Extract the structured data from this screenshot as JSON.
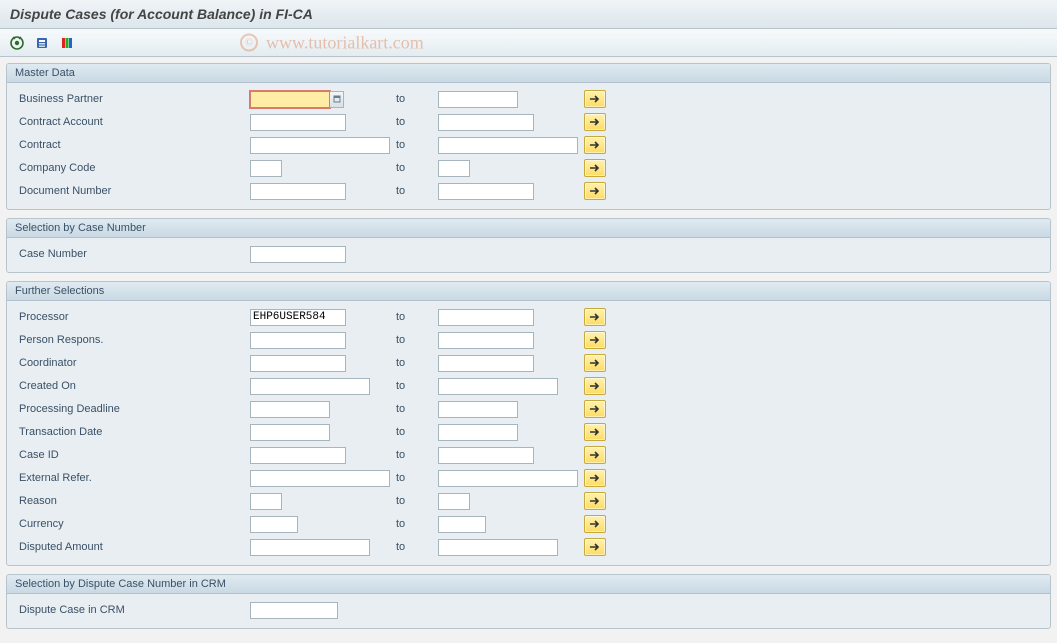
{
  "window_title": "Dispute Cases (for Account Balance) in FI-CA",
  "watermark": "www.tutorialkart.com",
  "toolbar": {
    "execute": "execute-icon",
    "variants": "variants-icon",
    "dynamic_selections": "dynamic-selections-icon"
  },
  "labels": {
    "to": "to"
  },
  "panels": {
    "master_data": {
      "title": "Master Data",
      "fields": {
        "business_partner": {
          "label": "Business Partner",
          "from": "",
          "to": ""
        },
        "contract_account": {
          "label": "Contract Account",
          "from": "",
          "to": ""
        },
        "contract": {
          "label": "Contract",
          "from": "",
          "to": ""
        },
        "company_code": {
          "label": "Company Code",
          "from": "",
          "to": ""
        },
        "document_number": {
          "label": "Document Number",
          "from": "",
          "to": ""
        }
      }
    },
    "case_number": {
      "title": "Selection by Case Number",
      "fields": {
        "case_number": {
          "label": "Case Number",
          "value": ""
        }
      }
    },
    "further": {
      "title": "Further Selections",
      "fields": {
        "processor": {
          "label": "Processor",
          "from": "EHP6USER584",
          "to": ""
        },
        "person_respons": {
          "label": "Person Respons.",
          "from": "",
          "to": ""
        },
        "coordinator": {
          "label": "Coordinator",
          "from": "",
          "to": ""
        },
        "created_on": {
          "label": "Created On",
          "from": "",
          "to": ""
        },
        "processing_deadline": {
          "label": "Processing Deadline",
          "from": "",
          "to": ""
        },
        "transaction_date": {
          "label": "Transaction Date",
          "from": "",
          "to": ""
        },
        "case_id": {
          "label": "Case ID",
          "from": "",
          "to": ""
        },
        "external_refer": {
          "label": "External Refer.",
          "from": "",
          "to": ""
        },
        "reason": {
          "label": "Reason",
          "from": "",
          "to": ""
        },
        "currency": {
          "label": "Currency",
          "from": "",
          "to": ""
        },
        "disputed_amount": {
          "label": "Disputed Amount",
          "from": "",
          "to": ""
        }
      }
    },
    "crm": {
      "title": "Selection by Dispute Case Number in CRM",
      "fields": {
        "dispute_case_crm": {
          "label": "Dispute Case in CRM",
          "value": ""
        }
      }
    }
  }
}
